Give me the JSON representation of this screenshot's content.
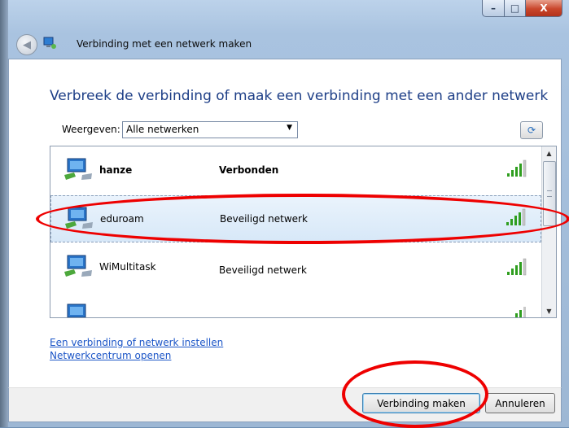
{
  "window": {
    "title": "Verbinding met een netwerk maken",
    "caption_buttons": {
      "minimize": "–",
      "maximize": "□",
      "close": "X"
    }
  },
  "main": {
    "instruction": "Verbreek de verbinding of maak een verbinding met een ander netwerk",
    "show_label": "Weergeven:",
    "show_select": {
      "value": "Alle netwerken"
    }
  },
  "networks": [
    {
      "name": "hanze",
      "status": "Verbonden",
      "bold": true,
      "signal_bars": 5
    },
    {
      "name": "eduroam",
      "status": "Beveiligd netwerk",
      "bold": false,
      "signal_bars": 5,
      "selected": true
    },
    {
      "name": "WiMultitask",
      "status": "Beveiligd netwerk",
      "bold": false,
      "signal_bars": 5
    },
    {
      "name": "",
      "status": "",
      "bold": false,
      "signal_bars": 5
    }
  ],
  "links": [
    "Een verbinding of netwerk instellen",
    "Netwerkcentrum openen"
  ],
  "buttons": {
    "connect": "Verbinding maken",
    "cancel": "Annuleren"
  },
  "colors": {
    "instruction_text": "#1e3f87",
    "link": "#1b55c7",
    "selection": "#d7e8f8",
    "annotation": "#e00000",
    "signal": "#2f9e1f"
  }
}
